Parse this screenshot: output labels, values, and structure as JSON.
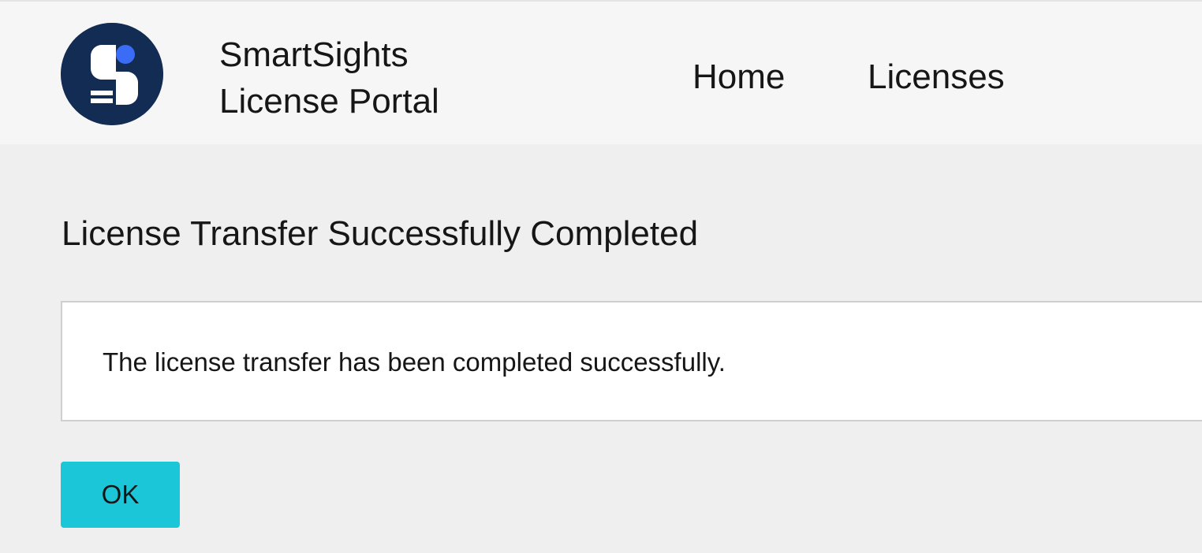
{
  "header": {
    "logo_icon": "smartsights-logo-icon",
    "brand_line1": "SmartSights",
    "brand_line2": "License Portal",
    "nav": {
      "home": "Home",
      "licenses": "Licenses"
    }
  },
  "main": {
    "title": "License Transfer Successfully Completed",
    "message": "The license transfer has been completed successfully.",
    "ok_label": "OK"
  },
  "colors": {
    "logo_background": "#132c54",
    "logo_accent": "#3b6cf6",
    "button_background": "#1ac6d8",
    "header_background": "#f6f6f6",
    "page_background": "#efefef"
  }
}
